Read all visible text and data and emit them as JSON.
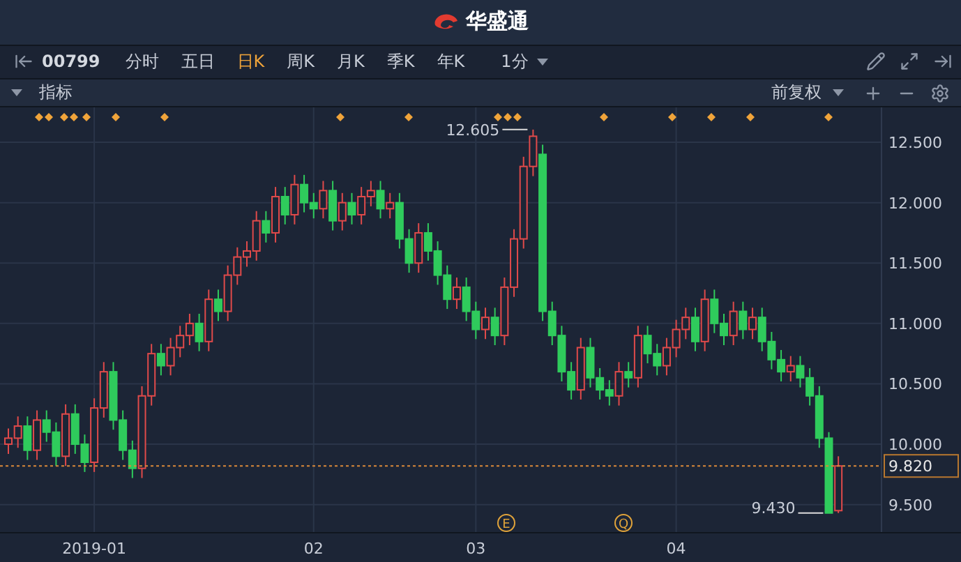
{
  "brand": {
    "name": "华盛通"
  },
  "toolbar": {
    "symbol": "00799",
    "interval": "1分",
    "periods": [
      {
        "label": "分时",
        "selected": false
      },
      {
        "label": "五日",
        "selected": false
      },
      {
        "label": "日K",
        "selected": true
      },
      {
        "label": "周K",
        "selected": false
      },
      {
        "label": "月K",
        "selected": false
      },
      {
        "label": "季K",
        "selected": false
      },
      {
        "label": "年K",
        "selected": false
      }
    ]
  },
  "indicator_bar": {
    "label": "指标",
    "adjustment": "前复权"
  },
  "chart": {
    "high_label": "12.605",
    "low_label": "9.430",
    "event_markers": [
      {
        "letter": "E"
      },
      {
        "letter": "Q"
      }
    ],
    "x_labels": [
      "2019-01",
      "02",
      "03",
      "04"
    ],
    "chart_data": {
      "type": "candlestick",
      "grid": true,
      "ylim": [
        9.267,
        12.789
      ],
      "ref_lines": [
        {
          "axis": "y",
          "value": 9.82,
          "label": "9.820",
          "color": "#d9893a"
        }
      ],
      "yticks": [
        {
          "value": 12.5,
          "label": "12.500"
        },
        {
          "value": 12,
          "label": "12.000"
        },
        {
          "value": 11.5,
          "label": "11.500"
        },
        {
          "value": 11,
          "label": "11.000"
        },
        {
          "value": 10.5,
          "label": "10.500"
        },
        {
          "value": 10,
          "label": "10.000"
        },
        {
          "value": 9.5,
          "label": "9.500"
        }
      ],
      "ohlc": [
        [
          10.0,
          10.13,
          9.92,
          10.05
        ],
        [
          10.05,
          10.23,
          9.97,
          10.15
        ],
        [
          10.15,
          10.23,
          9.87,
          9.95
        ],
        [
          9.95,
          10.28,
          9.87,
          10.2
        ],
        [
          10.2,
          10.28,
          10.02,
          10.1
        ],
        [
          10.1,
          10.18,
          9.82,
          9.9
        ],
        [
          9.9,
          10.33,
          9.82,
          10.25
        ],
        [
          10.25,
          10.33,
          9.92,
          10.0
        ],
        [
          10.0,
          10.08,
          9.77,
          9.85
        ],
        [
          9.85,
          10.38,
          9.77,
          10.3
        ],
        [
          10.3,
          10.68,
          10.22,
          10.6
        ],
        [
          10.6,
          10.68,
          10.12,
          10.2
        ],
        [
          10.2,
          10.28,
          9.87,
          9.95
        ],
        [
          9.95,
          10.03,
          9.72,
          9.8
        ],
        [
          9.8,
          10.48,
          9.72,
          10.4
        ],
        [
          10.4,
          10.83,
          10.32,
          10.75
        ],
        [
          10.75,
          10.83,
          10.57,
          10.65
        ],
        [
          10.65,
          10.88,
          10.57,
          10.8
        ],
        [
          10.8,
          10.98,
          10.72,
          10.9
        ],
        [
          10.9,
          11.08,
          10.82,
          11.0
        ],
        [
          11.0,
          11.08,
          10.77,
          10.85
        ],
        [
          10.85,
          11.28,
          10.77,
          11.2
        ],
        [
          11.2,
          11.28,
          11.02,
          11.1
        ],
        [
          11.1,
          11.48,
          11.02,
          11.4
        ],
        [
          11.4,
          11.63,
          11.32,
          11.55
        ],
        [
          11.55,
          11.68,
          11.47,
          11.6
        ],
        [
          11.6,
          11.93,
          11.52,
          11.85
        ],
        [
          11.85,
          11.93,
          11.67,
          11.75
        ],
        [
          11.75,
          12.13,
          11.67,
          12.05
        ],
        [
          12.05,
          12.13,
          11.82,
          11.9
        ],
        [
          11.9,
          12.23,
          11.82,
          12.15
        ],
        [
          12.15,
          12.23,
          11.92,
          12.0
        ],
        [
          12.0,
          12.08,
          11.87,
          11.95
        ],
        [
          11.95,
          12.18,
          11.87,
          12.1
        ],
        [
          12.1,
          12.18,
          11.77,
          11.85
        ],
        [
          11.85,
          12.08,
          11.77,
          12.0
        ],
        [
          12.0,
          12.08,
          11.82,
          11.9
        ],
        [
          11.9,
          12.13,
          11.82,
          12.05
        ],
        [
          12.05,
          12.18,
          11.97,
          12.1
        ],
        [
          12.1,
          12.18,
          11.87,
          11.95
        ],
        [
          11.95,
          12.08,
          11.87,
          12.0
        ],
        [
          12.0,
          12.08,
          11.62,
          11.7
        ],
        [
          11.7,
          11.78,
          11.42,
          11.5
        ],
        [
          11.5,
          11.83,
          11.42,
          11.75
        ],
        [
          11.75,
          11.83,
          11.52,
          11.6
        ],
        [
          11.6,
          11.68,
          11.32,
          11.4
        ],
        [
          11.4,
          11.48,
          11.12,
          11.2
        ],
        [
          11.2,
          11.38,
          11.12,
          11.3
        ],
        [
          11.3,
          11.38,
          11.02,
          11.1
        ],
        [
          11.1,
          11.18,
          10.87,
          10.95
        ],
        [
          10.95,
          11.13,
          10.87,
          11.05
        ],
        [
          11.05,
          11.13,
          10.82,
          10.9
        ],
        [
          10.9,
          11.38,
          10.82,
          11.3
        ],
        [
          11.3,
          11.78,
          11.22,
          11.7
        ],
        [
          11.7,
          12.38,
          11.62,
          12.3
        ],
        [
          12.3,
          12.605,
          12.22,
          12.55
        ],
        [
          12.4,
          12.48,
          11.02,
          11.1
        ],
        [
          11.1,
          11.18,
          10.82,
          10.9
        ],
        [
          10.9,
          10.98,
          10.52,
          10.6
        ],
        [
          10.6,
          10.68,
          10.37,
          10.45
        ],
        [
          10.45,
          10.88,
          10.37,
          10.8
        ],
        [
          10.8,
          10.88,
          10.47,
          10.55
        ],
        [
          10.55,
          10.63,
          10.37,
          10.45
        ],
        [
          10.45,
          10.53,
          10.32,
          10.4
        ],
        [
          10.4,
          10.68,
          10.32,
          10.6
        ],
        [
          10.6,
          10.68,
          10.47,
          10.55
        ],
        [
          10.55,
          10.98,
          10.47,
          10.9
        ],
        [
          10.9,
          10.98,
          10.67,
          10.75
        ],
        [
          10.75,
          10.83,
          10.57,
          10.65
        ],
        [
          10.65,
          10.88,
          10.57,
          10.8
        ],
        [
          10.8,
          11.03,
          10.72,
          10.95
        ],
        [
          10.95,
          11.13,
          10.87,
          11.05
        ],
        [
          11.05,
          11.13,
          10.77,
          10.85
        ],
        [
          10.85,
          11.28,
          10.77,
          11.2
        ],
        [
          11.2,
          11.28,
          10.92,
          11.0
        ],
        [
          11.0,
          11.08,
          10.82,
          10.9
        ],
        [
          10.9,
          11.18,
          10.82,
          11.1
        ],
        [
          11.1,
          11.18,
          10.87,
          10.95
        ],
        [
          10.95,
          11.13,
          10.87,
          11.05
        ],
        [
          11.05,
          11.13,
          10.77,
          10.85
        ],
        [
          10.85,
          10.93,
          10.62,
          10.7
        ],
        [
          10.7,
          10.78,
          10.52,
          10.6
        ],
        [
          10.6,
          10.73,
          10.52,
          10.65
        ],
        [
          10.65,
          10.73,
          10.47,
          10.55
        ],
        [
          10.55,
          10.63,
          10.32,
          10.4
        ],
        [
          10.4,
          10.48,
          9.97,
          10.05
        ],
        [
          10.05,
          10.1,
          9.43,
          9.43
        ],
        [
          9.45,
          9.9,
          9.43,
          9.82
        ]
      ]
    }
  }
}
